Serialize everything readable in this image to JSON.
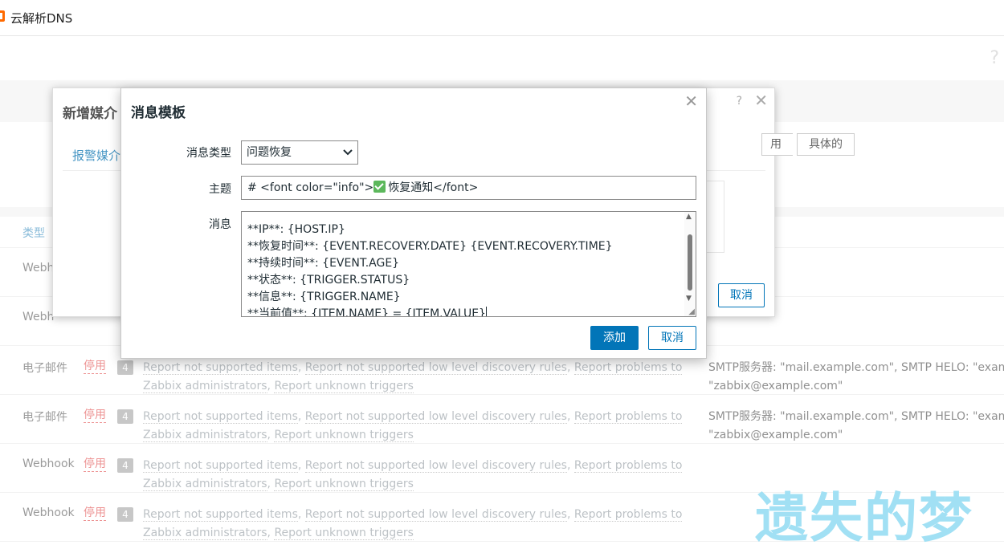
{
  "app": {
    "title": "云解析DNS",
    "help": "?"
  },
  "table": {
    "column_type": "类型",
    "rows": [
      {
        "type": "Webh",
        "status": "",
        "count": "",
        "actions": [],
        "details": []
      },
      {
        "type": "Webh",
        "status": "",
        "count": "",
        "actions": [],
        "details": []
      },
      {
        "type": "电子邮件",
        "status": "停用",
        "count": "4",
        "actions": [
          "Report not supported items",
          "Report not supported low level discovery rules",
          "Report problems to Zabbix administrators",
          "Report unknown triggers"
        ],
        "details": [
          "SMTP服务器: \"mail.example.com\", SMTP HELO: \"exam",
          "\"zabbix@example.com\""
        ]
      },
      {
        "type": "电子邮件",
        "status": "停用",
        "count": "4",
        "actions": [
          "Report not supported items",
          "Report not supported low level discovery rules",
          "Report problems to Zabbix administrators",
          "Report unknown triggers"
        ],
        "details": [
          "SMTP服务器: \"mail.example.com\", SMTP HELO: \"exam",
          "\"zabbix@example.com\""
        ]
      },
      {
        "type": "Webhook",
        "status": "停用",
        "count": "4",
        "actions": [
          "Report not supported items",
          "Report not supported low level discovery rules",
          "Report problems to Zabbix administrators",
          "Report unknown triggers"
        ],
        "details": []
      },
      {
        "type": "Webhook",
        "status": "停用",
        "count": "4",
        "actions": [
          "Report not supported items",
          "Report not supported low level discovery rules",
          "Report problems to Zabbix administrators",
          "Report unknown triggers"
        ],
        "details": []
      }
    ]
  },
  "back_dialog": {
    "title": "新增媒介",
    "tab": "报警媒介",
    "help": "?",
    "close": "✕",
    "segments": [
      "用",
      "具体的"
    ],
    "cancel": "取消"
  },
  "dialog": {
    "title": "消息模板",
    "close": "✕",
    "type_label": "消息类型",
    "type_value": "问题恢复",
    "subject_label": "主题",
    "subject_prefix": "# <font color=\"info\">",
    "subject_suffix": "恢复通知</font>",
    "message_label": "消息",
    "message_lines": [
      "**IP**: {HOST.IP}",
      "**恢复时间**: {EVENT.RECOVERY.DATE} {EVENT.RECOVERY.TIME}",
      "**持续时间**: {EVENT.AGE}",
      "**状态**: {TRIGGER.STATUS}",
      "**信息**: {TRIGGER.NAME}",
      "**当前值**: {ITEM.NAME} = {ITEM.VALUE}"
    ],
    "add_button": "添加",
    "cancel_button": "取消"
  },
  "watermark": "遗失的梦",
  "colors": {
    "primary": "#0275b8",
    "link": "#4796c4",
    "disabled": "#e45959",
    "check": "#5cb85c"
  }
}
